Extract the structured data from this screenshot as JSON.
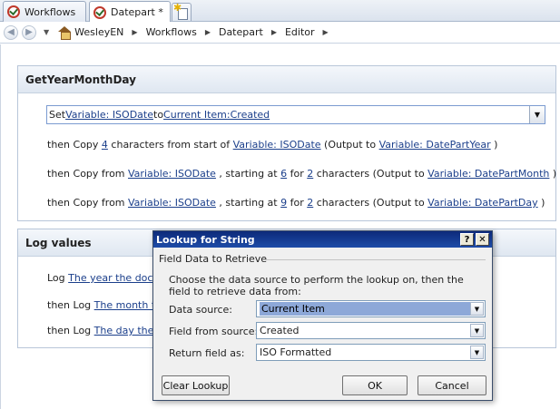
{
  "tabs": [
    {
      "label": "Workflows"
    },
    {
      "label": "Datepart *"
    }
  ],
  "breadcrumb": [
    "WesleyEN",
    "Workflows",
    "Datepart",
    "Editor"
  ],
  "step1": {
    "title": "GetYearMonthDay",
    "line1": {
      "t1": "Set ",
      "l1": "Variable: ISODate",
      "t2": " to ",
      "l2": "Current Item:Created"
    },
    "line2": {
      "t1": "then Copy ",
      "l1": "4",
      "t2": " characters from start of ",
      "l2": "Variable: ISODate",
      "t3": " (Output to ",
      "l3": "Variable: DatePartYear",
      "t4": " )"
    },
    "line3": {
      "t1": "then Copy from ",
      "l1": "Variable: ISODate",
      "t2": " , starting at ",
      "l2": "6",
      "t3": " for ",
      "l3": "2",
      "t4": " characters (Output to ",
      "l4": "Variable: DatePartMonth",
      "t5": " )"
    },
    "line4": {
      "t1": "then Copy from ",
      "l1": "Variable: ISODate",
      "t2": " , starting at ",
      "l2": "9",
      "t3": " for ",
      "l3": "2",
      "t4": " characters (Output to ",
      "l4": "Variable: DatePartDay",
      "t5": " )"
    }
  },
  "step2": {
    "title": "Log values",
    "line1": {
      "t1": "Log ",
      "l1": "The year the docu"
    },
    "line2": {
      "t1": "then Log ",
      "l1": "The month t"
    },
    "line3": {
      "t1": "then Log ",
      "l1": "The day the"
    }
  },
  "dialog": {
    "title": "Lookup for String",
    "help": "?",
    "close": "✕",
    "group": "Field Data to Retrieve",
    "desc": "Choose the data source to perform the lookup on, then the field to retrieve data from:",
    "fields": [
      {
        "label": "Data source:",
        "value": "Current Item"
      },
      {
        "label": "Field from source:",
        "value": "Created"
      },
      {
        "label": "Return field as:",
        "value": "ISO Formatted"
      }
    ],
    "clear": "Clear Lookup",
    "ok": "OK",
    "cancel": "Cancel"
  },
  "icons": {
    "dropdown": "chevron-down-icon",
    "nav_back": "back-arrow-icon",
    "nav_forward": "forward-arrow-icon"
  }
}
